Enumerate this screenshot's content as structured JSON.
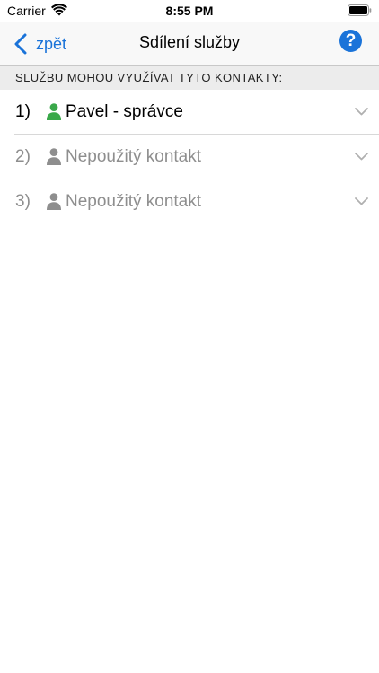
{
  "status_bar": {
    "carrier": "Carrier",
    "time": "8:55 PM"
  },
  "nav": {
    "back_label": "zpět",
    "title": "Sdílení služby",
    "help_label": "?"
  },
  "section": {
    "header": "SLUŽBU MOHOU VYUŽÍVAT TYTO KONTAKTY:"
  },
  "contacts": [
    {
      "index": "1)",
      "name": "Pavel - správce",
      "active": true
    },
    {
      "index": "2)",
      "name": "Nepoužitý kontakt",
      "active": false
    },
    {
      "index": "3)",
      "name": "Nepoužitý kontakt",
      "active": false
    }
  ],
  "colors": {
    "accent": "#1a73d9",
    "active_person": "#3aa84a",
    "inactive": "#8e8e8e"
  }
}
